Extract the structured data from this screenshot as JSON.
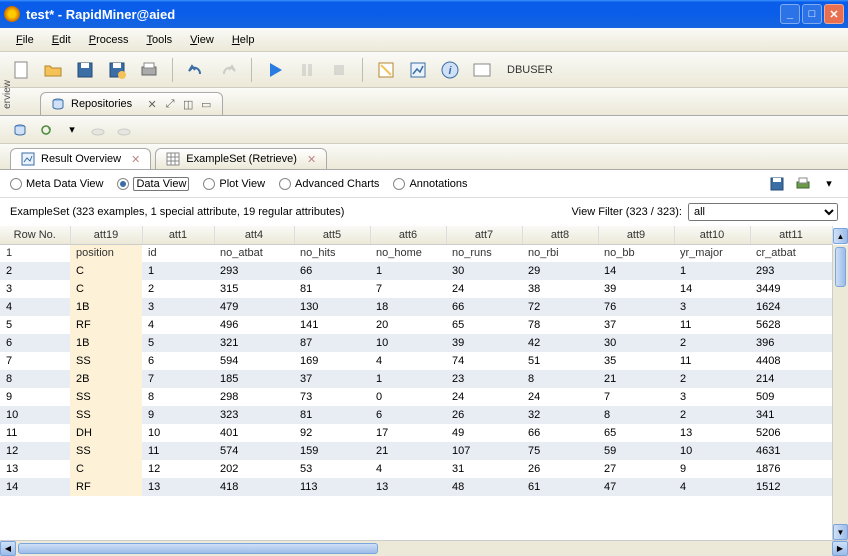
{
  "window": {
    "title": "test* - RapidMiner@aied"
  },
  "menu": {
    "file": "File",
    "edit": "Edit",
    "process": "Process",
    "tools": "Tools",
    "view": "View",
    "help": "Help"
  },
  "toolbar": {
    "dbuser": "DBUSER"
  },
  "repoTab": {
    "label": "Repositories"
  },
  "resultTabs": {
    "overview": "Result Overview",
    "exampleset": "ExampleSet (Retrieve)"
  },
  "views": {
    "meta": "Meta Data View",
    "data": "Data View",
    "plot": "Plot View",
    "advanced": "Advanced Charts",
    "anno": "Annotations"
  },
  "summary": "ExampleSet (323 examples, 1 special attribute, 19 regular attributes)",
  "filter": {
    "label": "View Filter (323 / 323):",
    "value": "all"
  },
  "columns": [
    "Row No.",
    "att19",
    "att1",
    "att4",
    "att5",
    "att6",
    "att7",
    "att8",
    "att9",
    "att10",
    "att11"
  ],
  "headerRow": [
    "",
    "position",
    "id",
    "no_atbat",
    "no_hits",
    "no_home",
    "no_runs",
    "no_rbi",
    "no_bb",
    "yr_major",
    "cr_atbat"
  ],
  "rows": [
    [
      "1",
      "",
      "",
      "",
      "",
      "",
      "",
      "",
      "",
      "",
      ""
    ],
    [
      "2",
      "C",
      "1",
      "293",
      "66",
      "1",
      "30",
      "29",
      "14",
      "1",
      "293"
    ],
    [
      "3",
      "C",
      "2",
      "315",
      "81",
      "7",
      "24",
      "38",
      "39",
      "14",
      "3449"
    ],
    [
      "4",
      "1B",
      "3",
      "479",
      "130",
      "18",
      "66",
      "72",
      "76",
      "3",
      "1624"
    ],
    [
      "5",
      "RF",
      "4",
      "496",
      "141",
      "20",
      "65",
      "78",
      "37",
      "11",
      "5628"
    ],
    [
      "6",
      "1B",
      "5",
      "321",
      "87",
      "10",
      "39",
      "42",
      "30",
      "2",
      "396"
    ],
    [
      "7",
      "SS",
      "6",
      "594",
      "169",
      "4",
      "74",
      "51",
      "35",
      "11",
      "4408"
    ],
    [
      "8",
      "2B",
      "7",
      "185",
      "37",
      "1",
      "23",
      "8",
      "21",
      "2",
      "214"
    ],
    [
      "9",
      "SS",
      "8",
      "298",
      "73",
      "0",
      "24",
      "24",
      "7",
      "3",
      "509"
    ],
    [
      "10",
      "SS",
      "9",
      "323",
      "81",
      "6",
      "26",
      "32",
      "8",
      "2",
      "341"
    ],
    [
      "11",
      "DH",
      "10",
      "401",
      "92",
      "17",
      "49",
      "66",
      "65",
      "13",
      "5206"
    ],
    [
      "12",
      "SS",
      "11",
      "574",
      "159",
      "21",
      "107",
      "75",
      "59",
      "10",
      "4631"
    ],
    [
      "13",
      "C",
      "12",
      "202",
      "53",
      "4",
      "31",
      "26",
      "27",
      "9",
      "1876"
    ],
    [
      "14",
      "RF",
      "13",
      "418",
      "113",
      "13",
      "48",
      "61",
      "47",
      "4",
      "1512"
    ]
  ]
}
